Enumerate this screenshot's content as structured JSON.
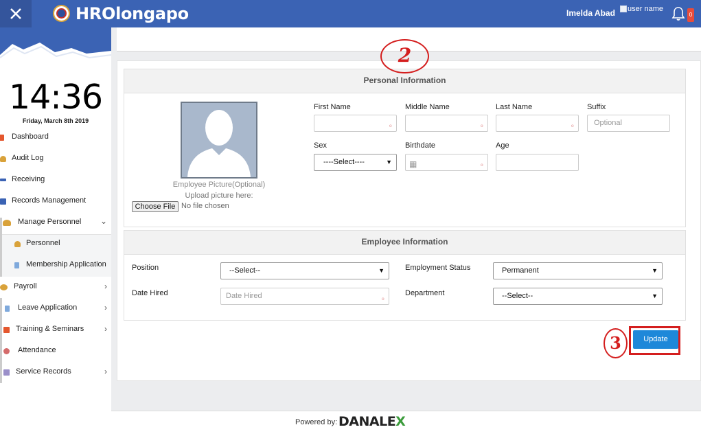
{
  "header": {
    "title": "HROlongapo",
    "user_name": "Imelda Abad",
    "user_image_alt": "user name",
    "notification_count": "0"
  },
  "sidebar": {
    "time": "14:36",
    "date": "Friday, March 8th 2019",
    "items": [
      {
        "label": "Dashboard"
      },
      {
        "label": "Audit Log"
      },
      {
        "label": "Receiving"
      },
      {
        "label": "Records Management"
      },
      {
        "label": "Manage Personnel"
      },
      {
        "label": "Personnel"
      },
      {
        "label": "Membership Application"
      },
      {
        "label": "Payroll"
      },
      {
        "label": "Leave Application"
      },
      {
        "label": "Training & Seminars"
      },
      {
        "label": "Attendance"
      },
      {
        "label": "Service Records"
      }
    ]
  },
  "personal_info": {
    "heading": "Personal Information",
    "photo_caption": "Employee Picture(Optional)",
    "upload_caption": "Upload picture here:",
    "choose_file_label": "Choose File",
    "no_file_label": "No file chosen",
    "first_name_label": "First Name",
    "middle_name_label": "Middle Name",
    "last_name_label": "Last Name",
    "suffix_label": "Suffix",
    "suffix_placeholder": "Optional",
    "sex_label": "Sex",
    "sex_value": "----Select----",
    "birthdate_label": "Birthdate",
    "age_label": "Age"
  },
  "employee_info": {
    "heading": "Employee Information",
    "position_label": "Position",
    "position_value": "--Select--",
    "employment_status_label": "Employment Status",
    "employment_status_value": "Permanent",
    "date_hired_label": "Date Hired",
    "date_hired_placeholder": "Date Hired",
    "department_label": "Department",
    "department_value": "--Select--"
  },
  "actions": {
    "update_label": "Update"
  },
  "annotations": {
    "step2": "2",
    "step3": "3"
  },
  "footer": {
    "powered_by": "Powered by:",
    "brand_a": "DANALE",
    "brand_b": "X"
  },
  "colors": {
    "topbar": "#3b63b4",
    "accent_button": "#1e88d9",
    "annotation": "#d41e1e"
  }
}
